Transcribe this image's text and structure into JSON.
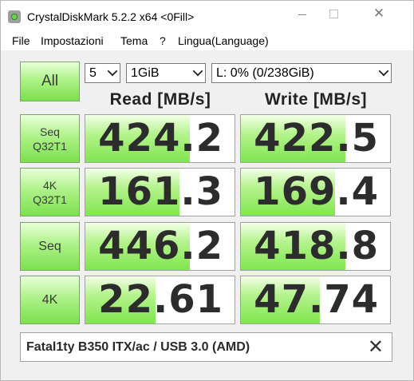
{
  "window": {
    "title": "CrystalDiskMark 5.2.2 x64 <0Fill>",
    "minimize_glyph": "",
    "close_glyph": "✕"
  },
  "menu": [
    "File",
    "Impostazioni",
    "Tema",
    "?",
    "Lingua(Language)"
  ],
  "controls": {
    "all_label": "All",
    "count": "5",
    "size": "1GiB",
    "drive": "L: 0% (0/238GiB)"
  },
  "headers": {
    "read": "Read [MB/s]",
    "write": "Write [MB/s]"
  },
  "rows": [
    {
      "label_line1": "Seq",
      "label_line2": "Q32T1",
      "read": "424.2",
      "write": "422.5",
      "read_fill": 0.7,
      "write_fill": 0.7
    },
    {
      "label_line1": "4K",
      "label_line2": "Q32T1",
      "read": "161.3",
      "write": "169.4",
      "read_fill": 0.63,
      "write_fill": 0.63
    },
    {
      "label_line1": "Seq",
      "label_line2": "",
      "read": "446.2",
      "write": "418.8",
      "read_fill": 0.7,
      "write_fill": 0.7
    },
    {
      "label_line1": "4K",
      "label_line2": "",
      "read": "22.61",
      "write": "47.74",
      "read_fill": 0.47,
      "write_fill": 0.53
    }
  ],
  "footer": {
    "comment": "Fatal1ty B350 ITX/ac / USB 3.0 (AMD)",
    "close_glyph": "✕"
  },
  "colors": {
    "green_fill": "#80e64f",
    "button_green": "#7ddf4e"
  }
}
